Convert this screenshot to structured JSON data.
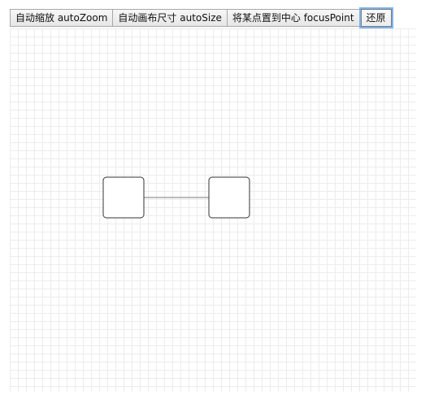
{
  "toolbar": {
    "auto_zoom_label": "自动缩放 autoZoom",
    "auto_size_label": "自动画布尺寸 autoSize",
    "focus_point_label": "将某点置到中心 focusPoint",
    "restore_label": "还原"
  },
  "graph": {
    "nodes": [
      {
        "id": "node-1",
        "label": ""
      },
      {
        "id": "node-2",
        "label": ""
      }
    ],
    "edges": [
      {
        "source": "node-1",
        "target": "node-2"
      }
    ],
    "colors": {
      "grid": "#ececec",
      "node_stroke": "#333333",
      "edge_stroke": "#7a7a7a",
      "focus_ring": "#7fb3ee"
    }
  }
}
